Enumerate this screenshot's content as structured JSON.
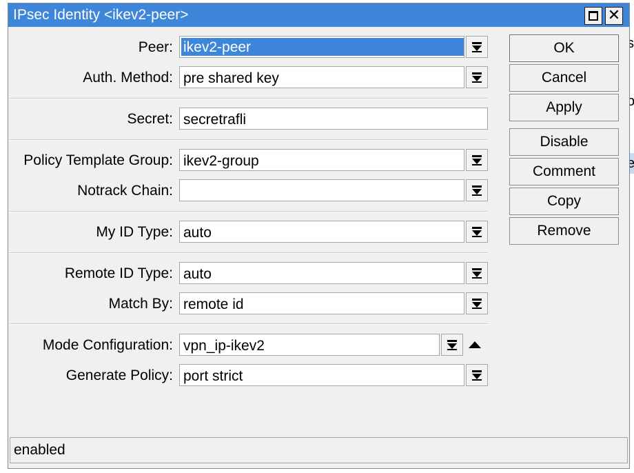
{
  "window": {
    "title": "IPsec Identity <ikev2-peer>"
  },
  "titlebar_buttons": {
    "maximize_icon": "maximize-icon",
    "close_icon": "close-icon"
  },
  "form": {
    "peer": {
      "label": "Peer:",
      "value": "ikev2-peer"
    },
    "auth_method": {
      "label": "Auth. Method:",
      "value": "pre shared key"
    },
    "secret": {
      "label": "Secret:",
      "value": "secretrafli"
    },
    "policy_template_group": {
      "label": "Policy Template Group:",
      "value": "ikev2-group"
    },
    "notrack_chain": {
      "label": "Notrack Chain:",
      "value": ""
    },
    "my_id_type": {
      "label": "My ID Type:",
      "value": "auto"
    },
    "remote_id_type": {
      "label": "Remote ID Type:",
      "value": "auto"
    },
    "match_by": {
      "label": "Match By:",
      "value": "remote id"
    },
    "mode_configuration": {
      "label": "Mode Configuration:",
      "value": "vpn_ip-ikev2"
    },
    "generate_policy": {
      "label": "Generate Policy:",
      "value": "port strict"
    }
  },
  "buttons": {
    "ok": "OK",
    "cancel": "Cancel",
    "apply": "Apply",
    "disable": "Disable",
    "comment": "Comment",
    "copy": "Copy",
    "remove": "Remove"
  },
  "status": "enabled",
  "background_fragments": [
    "st",
    "or",
    "e"
  ],
  "colors": {
    "titlebar": "#3d86d9",
    "selection": "#3d86d9",
    "window_bg": "#f0f0f0"
  }
}
